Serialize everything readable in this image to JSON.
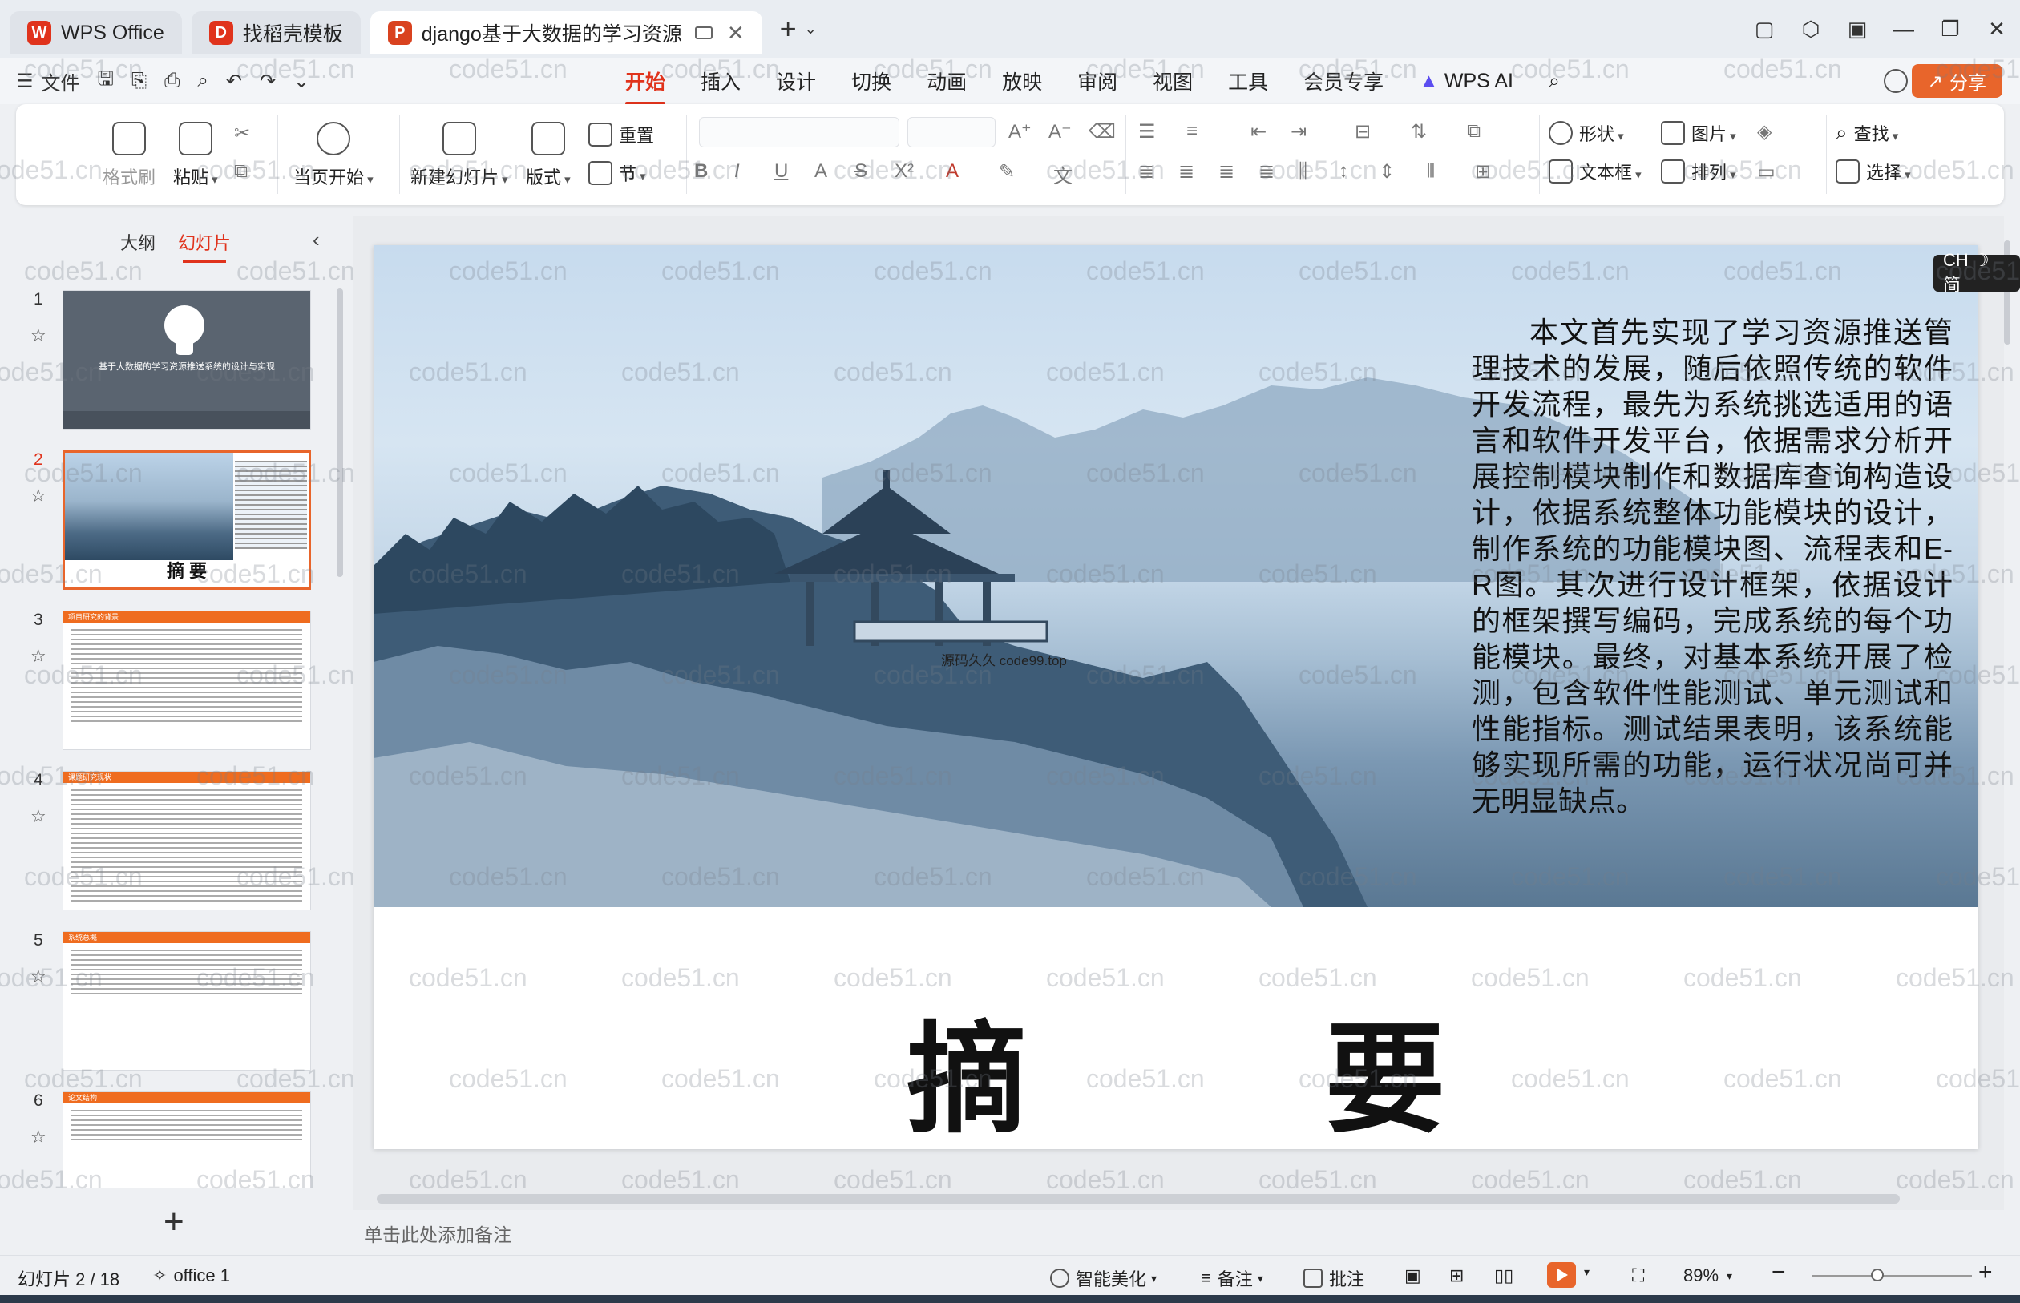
{
  "titlebar": {
    "tabs": [
      {
        "label": "WPS Office",
        "color": "#e0331c"
      },
      {
        "label": "找稻壳模板",
        "color": "#e0331c"
      },
      {
        "label": "django基于大数据的学习资源",
        "color": "#d9421f"
      }
    ]
  },
  "menu": {
    "file": "文件",
    "tabs": [
      "开始",
      "插入",
      "设计",
      "切换",
      "动画",
      "放映",
      "审阅",
      "视图",
      "工具",
      "会员专享"
    ],
    "active_tab": "开始",
    "wps_ai": "WPS AI",
    "share": "分享"
  },
  "ribbon": {
    "format_brush": "格式刷",
    "paste": "粘贴",
    "play_from_current": "当页开始",
    "new_slide": "新建幻灯片",
    "layout": "版式",
    "reset": "重置",
    "section": "节",
    "shape": "形状",
    "picture": "图片",
    "textbox": "文本框",
    "arrange": "排列",
    "find": "查找",
    "select": "选择"
  },
  "leftpanel": {
    "tab_outline": "大纲",
    "tab_slides": "幻灯片",
    "slides": [
      {
        "num": "1",
        "title": "基于大数据的学习资源推送系统的设计与实现"
      },
      {
        "num": "2",
        "title": "摘  要"
      },
      {
        "num": "3",
        "title": "项目研究的背景"
      },
      {
        "num": "4",
        "title": "课题研究现状"
      },
      {
        "num": "5",
        "title": "系统总概"
      },
      {
        "num": "6",
        "title": "论文结构"
      }
    ]
  },
  "slide": {
    "abstract": "本文首先实现了学习资源推送管理技术的发展，随后依照传统的软件开发流程，最先为系统挑选适用的语言和软件开发平台，依据需求分析开展控制模块制作和数据库查询构造设计，依据系统整体功能模块的设计，制作系统的功能模块图、流程表和E-R图。其次进行设计框架，依据设计的框架撰写编码，完成系统的每个功能模块。最终，对基本系统开展了检测，包含软件性能测试、单元测试和性能指标。测试结果表明，该系统能够实现所需的功能，运行状况尚可并无明显缺点。",
    "image_watermark": "源码久久 code99.top",
    "title": "摘    要"
  },
  "ime": "CH ☽ 简",
  "notes_placeholder": "单击此处添加备注",
  "statusbar": {
    "slide_info": "幻灯片 2 / 18",
    "theme": "office 1",
    "beautify": "智能美化",
    "notes": "备注",
    "comment": "批注",
    "zoom": "89%"
  },
  "watermark": "code51.cn"
}
